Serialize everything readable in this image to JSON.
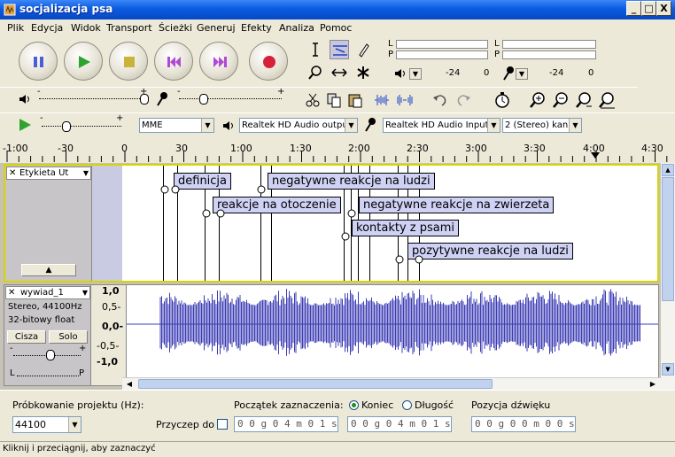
{
  "window": {
    "title": "socjalizacja psa",
    "min": "_",
    "max": "□",
    "close": "X"
  },
  "menu": [
    "Plik",
    "Edycja",
    "Widok",
    "Transport",
    "Ścieżki",
    "Generuj",
    "Efekty",
    "Analiza",
    "Pomoc"
  ],
  "meter": {
    "L": "L",
    "P": "P",
    "scale_a": "-24",
    "scale_b": "0",
    "scale_c": "-24",
    "scale_d": "0"
  },
  "mixer": {
    "plus": "+",
    "minus": "-"
  },
  "device": {
    "host": "MME",
    "output": "Realtek HD Audio outpu",
    "input": "Realtek HD Audio Input:",
    "channels": "2 (Stereo) kan"
  },
  "ruler": {
    "ticks": [
      "-1:00",
      "-30",
      "0",
      "30",
      "1:00",
      "1:30",
      "2:00",
      "2:30",
      "3:00",
      "3:30",
      "4:00",
      "4:30"
    ]
  },
  "label_track": {
    "name": "Etykieta Ut",
    "labels": [
      "definicja",
      "negatywne reakcje na ludzi",
      "reakcje na otoczenie",
      "negatywne reakcje na zwierzeta",
      "kontakty z psami",
      "pozytywne reakcje na ludzi"
    ]
  },
  "audio_track": {
    "name": "wywiad_1",
    "info1": "Stereo, 44100Hz",
    "info2": "32-bitowy float",
    "mute": "Cisza",
    "solo": "Solo",
    "lr": "L",
    "rr": "P",
    "scale": [
      "1,0",
      "0,5-",
      "0,0-",
      "-0,5-",
      "-1,0"
    ]
  },
  "selbar": {
    "rate_label": "Próbkowanie projektu (Hz):",
    "rate": "44100",
    "snap": "Przyczep do",
    "start_label": "Początek zaznaczenia:",
    "end": "Koniec",
    "length": "Długość",
    "pos_label": "Pozycja dźwięku",
    "start_val": "0 0 g 0 4 m 0 1 s",
    "end_val": "0 0 g 0 4 m 0 1 s",
    "pos_val": "0 0 g 0 0 m 0 0 s"
  },
  "status": "Kliknij i przeciągnij, aby zaznaczyć"
}
